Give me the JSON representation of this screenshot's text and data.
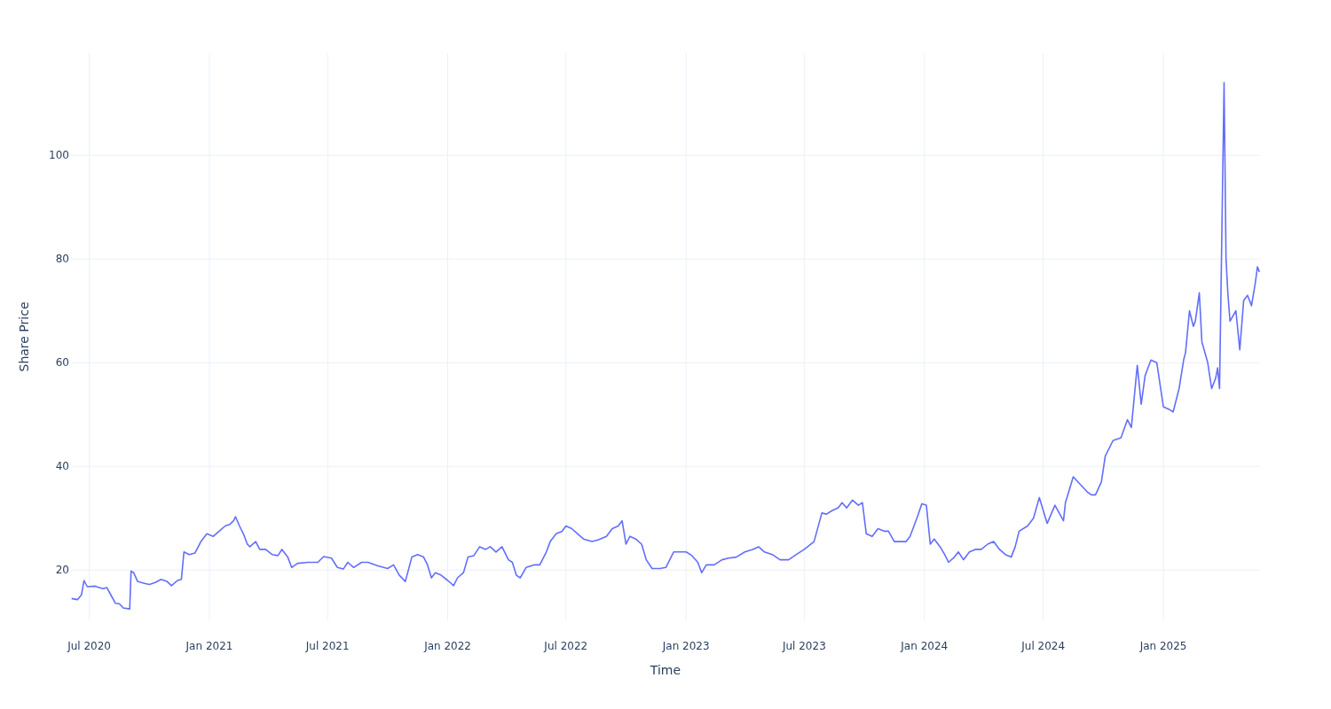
{
  "chart_data": {
    "type": "line",
    "grid": true,
    "xlabel": "Time",
    "ylabel": "Share Price",
    "xlim": [
      "2020-06-03",
      "2025-05-29"
    ],
    "ylim": [
      10.3,
      119.7
    ],
    "xticks": [
      {
        "value": "2020-07-01",
        "label": "Jul 2020"
      },
      {
        "value": "2021-01-01",
        "label": "Jan 2021"
      },
      {
        "value": "2021-07-01",
        "label": "Jul 2021"
      },
      {
        "value": "2022-01-01",
        "label": "Jan 2022"
      },
      {
        "value": "2022-07-01",
        "label": "Jul 2022"
      },
      {
        "value": "2023-01-01",
        "label": "Jan 2023"
      },
      {
        "value": "2023-07-01",
        "label": "Jul 2023"
      },
      {
        "value": "2024-01-01",
        "label": "Jan 2024"
      },
      {
        "value": "2024-07-01",
        "label": "Jul 2024"
      },
      {
        "value": "2025-01-01",
        "label": "Jan 2025"
      }
    ],
    "yticks": [
      20,
      40,
      60,
      80,
      100
    ],
    "x": [
      "2020-06-04",
      "2020-06-13",
      "2020-06-19",
      "2020-06-23",
      "2020-06-28",
      "2020-07-10",
      "2020-07-22",
      "2020-07-28",
      "2020-08-04",
      "2020-08-10",
      "2020-08-16",
      "2020-08-22",
      "2020-09-01",
      "2020-09-03",
      "2020-09-07",
      "2020-09-13",
      "2020-09-22",
      "2020-10-01",
      "2020-10-10",
      "2020-10-19",
      "2020-10-28",
      "2020-11-04",
      "2020-11-13",
      "2020-11-19",
      "2020-11-23",
      "2020-12-01",
      "2020-12-10",
      "2020-12-19",
      "2020-12-28",
      "2021-01-07",
      "2021-01-16",
      "2021-01-25",
      "2021-02-01",
      "2021-02-07",
      "2021-02-10",
      "2021-02-16",
      "2021-02-22",
      "2021-02-28",
      "2021-03-04",
      "2021-03-13",
      "2021-03-19",
      "2021-03-28",
      "2021-04-07",
      "2021-04-16",
      "2021-04-22",
      "2021-05-01",
      "2021-05-07",
      "2021-05-16",
      "2021-06-01",
      "2021-06-16",
      "2021-06-25",
      "2021-07-07",
      "2021-07-16",
      "2021-07-25",
      "2021-08-01",
      "2021-08-10",
      "2021-08-22",
      "2021-09-01",
      "2021-09-16",
      "2021-10-01",
      "2021-10-10",
      "2021-10-19",
      "2021-10-28",
      "2021-11-07",
      "2021-11-16",
      "2021-11-25",
      "2021-12-01",
      "2021-12-07",
      "2021-12-13",
      "2021-12-22",
      "2022-01-01",
      "2022-01-10",
      "2022-01-16",
      "2022-01-25",
      "2022-02-01",
      "2022-02-10",
      "2022-02-19",
      "2022-02-28",
      "2022-03-07",
      "2022-03-16",
      "2022-03-25",
      "2022-04-04",
      "2022-04-10",
      "2022-04-16",
      "2022-04-22",
      "2022-05-01",
      "2022-05-13",
      "2022-05-22",
      "2022-06-01",
      "2022-06-07",
      "2022-06-16",
      "2022-06-25",
      "2022-07-01",
      "2022-07-10",
      "2022-07-19",
      "2022-07-28",
      "2022-08-10",
      "2022-08-19",
      "2022-09-01",
      "2022-09-10",
      "2022-09-19",
      "2022-09-25",
      "2022-10-01",
      "2022-10-07",
      "2022-10-16",
      "2022-10-25",
      "2022-11-01",
      "2022-11-10",
      "2022-11-22",
      "2022-12-01",
      "2022-12-13",
      "2022-12-22",
      "2023-01-01",
      "2023-01-10",
      "2023-01-19",
      "2023-01-25",
      "2023-02-01",
      "2023-02-13",
      "2023-02-25",
      "2023-03-07",
      "2023-03-19",
      "2023-04-01",
      "2023-04-13",
      "2023-04-22",
      "2023-05-01",
      "2023-05-13",
      "2023-05-25",
      "2023-06-07",
      "2023-06-19",
      "2023-07-01",
      "2023-07-16",
      "2023-07-28",
      "2023-08-04",
      "2023-08-13",
      "2023-08-22",
      "2023-08-28",
      "2023-09-04",
      "2023-09-13",
      "2023-09-22",
      "2023-09-28",
      "2023-10-04",
      "2023-10-13",
      "2023-10-22",
      "2023-11-01",
      "2023-11-07",
      "2023-11-16",
      "2023-11-25",
      "2023-12-04",
      "2023-12-10",
      "2023-12-16",
      "2023-12-22",
      "2023-12-28",
      "2024-01-04",
      "2024-01-10",
      "2024-01-16",
      "2024-01-25",
      "2024-02-01",
      "2024-02-07",
      "2024-02-16",
      "2024-02-22",
      "2024-03-01",
      "2024-03-10",
      "2024-03-19",
      "2024-03-28",
      "2024-04-07",
      "2024-04-16",
      "2024-04-25",
      "2024-05-04",
      "2024-05-13",
      "2024-05-19",
      "2024-05-25",
      "2024-06-07",
      "2024-06-16",
      "2024-06-25",
      "2024-07-07",
      "2024-07-19",
      "2024-08-01",
      "2024-08-04",
      "2024-08-16",
      "2024-09-07",
      "2024-09-13",
      "2024-09-19",
      "2024-09-28",
      "2024-10-04",
      "2024-10-16",
      "2024-10-28",
      "2024-11-07",
      "2024-11-13",
      "2024-11-22",
      "2024-11-28",
      "2024-12-04",
      "2024-12-07",
      "2024-12-13",
      "2024-12-22",
      "2025-01-01",
      "2025-01-10",
      "2025-01-16",
      "2025-01-25",
      "2025-02-01",
      "2025-02-04",
      "2025-02-10",
      "2025-02-16",
      "2025-02-19",
      "2025-02-25",
      "2025-03-01",
      "2025-03-10",
      "2025-03-16",
      "2025-03-22",
      "2025-03-25",
      "2025-03-28",
      "2025-04-04",
      "2025-04-07",
      "2025-04-10",
      "2025-04-13",
      "2025-04-22",
      "2025-04-28",
      "2025-05-04",
      "2025-05-10",
      "2025-05-16",
      "2025-05-22",
      "2025-05-25",
      "2025-05-28"
    ],
    "series": [
      {
        "color": "#636efa",
        "values": [
          14.5,
          14.3,
          15.2,
          18.0,
          16.8,
          16.9,
          16.4,
          16.6,
          15.0,
          13.6,
          13.5,
          12.7,
          12.5,
          19.8,
          19.5,
          17.8,
          17.5,
          17.2,
          17.6,
          18.2,
          17.8,
          17.0,
          18.0,
          18.2,
          23.5,
          23.0,
          23.3,
          25.5,
          27.0,
          26.5,
          27.5,
          28.5,
          28.8,
          29.5,
          30.3,
          28.5,
          27.0,
          25.0,
          24.5,
          25.5,
          24.0,
          24.0,
          23.0,
          22.8,
          24.0,
          22.5,
          20.5,
          21.3,
          21.5,
          21.5,
          22.6,
          22.3,
          20.5,
          20.2,
          21.5,
          20.5,
          21.5,
          21.5,
          20.8,
          20.3,
          21.0,
          19.0,
          17.8,
          22.5,
          23.0,
          22.5,
          21.0,
          18.5,
          19.5,
          19.0,
          18.0,
          17.0,
          18.5,
          19.5,
          22.5,
          22.8,
          24.5,
          24.0,
          24.5,
          23.5,
          24.5,
          22.0,
          21.5,
          19.0,
          18.5,
          20.5,
          21.0,
          21.0,
          23.5,
          25.5,
          27.0,
          27.5,
          28.5,
          28.0,
          27.0,
          26.0,
          25.5,
          25.8,
          26.5,
          28.0,
          28.5,
          29.5,
          25.0,
          26.5,
          26.0,
          25.0,
          22.0,
          20.3,
          20.3,
          20.5,
          23.5,
          23.5,
          23.5,
          22.8,
          21.5,
          19.5,
          21.0,
          21.0,
          22.0,
          22.3,
          22.5,
          23.5,
          24.0,
          24.5,
          23.5,
          23.0,
          22.0,
          22.0,
          23.0,
          24.0,
          25.5,
          31.0,
          30.8,
          31.5,
          32.0,
          33.0,
          32.0,
          33.5,
          32.5,
          33.0,
          27.0,
          26.5,
          28.0,
          27.5,
          27.5,
          25.5,
          25.5,
          25.5,
          26.5,
          28.5,
          30.5,
          32.8,
          32.5,
          25.0,
          26.0,
          24.5,
          23.0,
          21.5,
          22.5,
          23.5,
          22.0,
          23.5,
          24.0,
          24.0,
          25.0,
          25.5,
          24.0,
          23.0,
          22.5,
          24.5,
          27.5,
          28.5,
          30.0,
          34.0,
          29.0,
          32.5,
          29.5,
          33.0,
          38.0,
          35.0,
          34.5,
          34.5,
          37.0,
          42.0,
          45.0,
          45.5,
          49.0,
          47.5,
          59.5,
          52.0,
          57.5,
          58.5,
          60.5,
          60.0,
          51.5,
          51.0,
          50.5,
          55.0,
          60.5,
          62.0,
          70.0,
          67.0,
          68.0,
          73.5,
          64.0,
          60.0,
          55.0,
          57.0,
          59.0,
          55.0,
          114.0,
          80.0,
          73.0,
          68.0,
          70.0,
          62.5,
          72.0,
          73.0,
          71.0,
          75.5,
          78.5,
          77.5
        ]
      }
    ]
  }
}
